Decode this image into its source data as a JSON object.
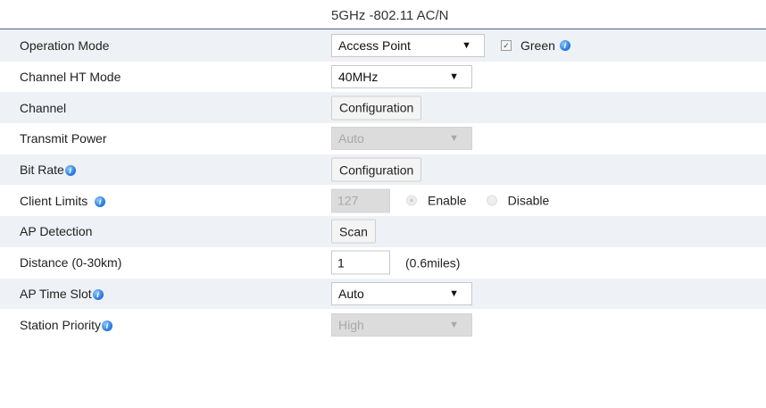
{
  "header": {
    "title": "5GHz -802.11 AC/N"
  },
  "rows": {
    "operation_mode": {
      "label": "Operation Mode",
      "select_value": "Access Point",
      "arrow": "▼",
      "checkbox_checked": true,
      "checkbox_label": "Green",
      "info_icon": "info-icon"
    },
    "channel_ht_mode": {
      "label": "Channel HT Mode",
      "select_value": "40MHz",
      "arrow": "▼"
    },
    "channel": {
      "label": "Channel",
      "button_label": "Configuration"
    },
    "transmit_power": {
      "label": "Transmit Power",
      "select_value": "Auto",
      "arrow": "▼",
      "disabled": true
    },
    "bit_rate": {
      "label": "Bit Rate",
      "info_icon": "info-icon",
      "button_label": "Configuration"
    },
    "client_limits": {
      "label": "Client Limits",
      "info_icon": "info-icon",
      "value": "127",
      "enable_label": "Enable",
      "disable_label": "Disable",
      "selected": "Enable",
      "disabled": true
    },
    "ap_detection": {
      "label": "AP Detection",
      "button_label": "Scan"
    },
    "distance": {
      "label": "Distance (0-30km)",
      "value": "1",
      "unit_text": "(0.6miles)"
    },
    "ap_time_slot": {
      "label": "AP Time Slot",
      "info_icon": "info-icon",
      "select_value": "Auto",
      "arrow": "▼"
    },
    "station_priority": {
      "label": "Station Priority",
      "info_icon": "info-icon",
      "select_value": "High",
      "arrow": "▼",
      "disabled": true
    }
  },
  "colors": {
    "header_rule": "#3a5a86",
    "alt_row": "#eef1f5",
    "info_icon": "#1f74d8",
    "disabled_control": "#dcdcdc"
  }
}
